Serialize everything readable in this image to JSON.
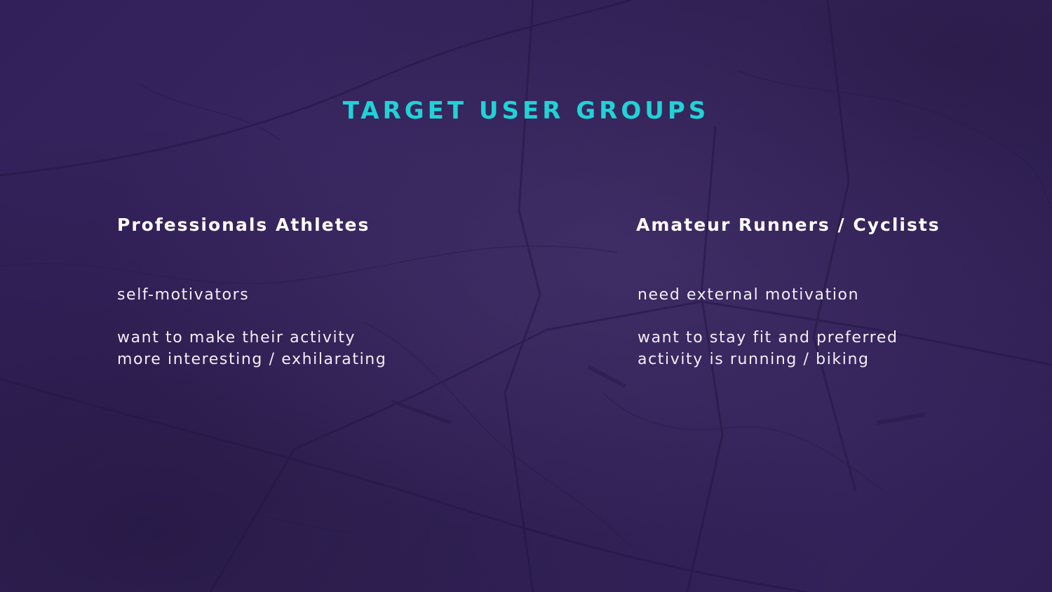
{
  "slide": {
    "title": "TARGET USER GROUPS",
    "colors": {
      "background": "#35235a",
      "title": "#1fd3d6",
      "text": "#ffffff"
    },
    "background_image": "faded-map-texture",
    "groups": [
      {
        "heading": "Professionals Athletes",
        "points": [
          {
            "line1": "self-motivators",
            "line2": ""
          },
          {
            "line1": "want to make their activity",
            "line2": "more interesting / exhilarating"
          }
        ]
      },
      {
        "heading": "Amateur Runners / Cyclists",
        "points": [
          {
            "line1": "need external motivation",
            "line2": ""
          },
          {
            "line1": "want to stay fit and preferred",
            "line2": "activity is running / biking"
          }
        ]
      }
    ]
  }
}
